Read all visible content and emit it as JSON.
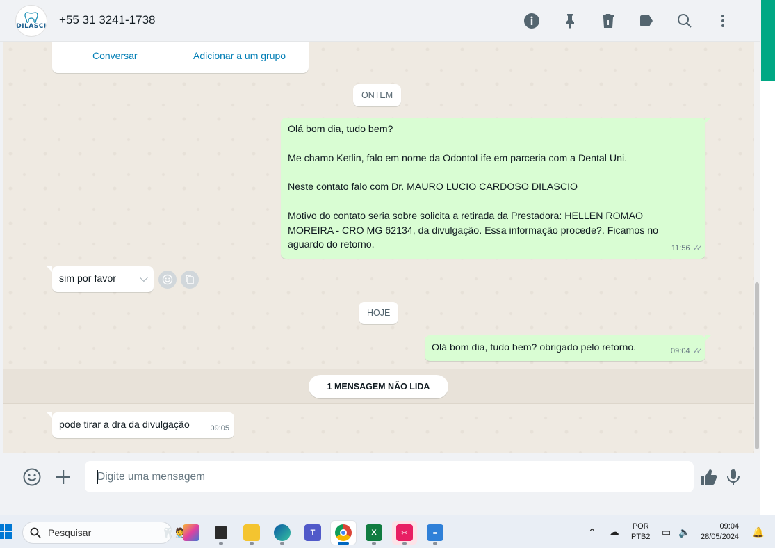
{
  "header": {
    "avatar_text": "DILASCI",
    "contact_name": "+55 31 3241-1738",
    "icons": [
      "info-icon",
      "pin-icon",
      "clear-chat-icon",
      "label-icon",
      "search-icon",
      "more-options-icon"
    ]
  },
  "contact_card": {
    "chat_label": "Conversar",
    "add_group_label": "Adicionar a um grupo"
  },
  "day_chips": {
    "yesterday": "ONTEM",
    "today": "HOJE"
  },
  "messages": [
    {
      "direction": "outgoing",
      "lines": [
        "Olá bom dia, tudo bem?",
        "Me chamo Ketlin, falo em nome da OdontoLife em parceria com a Dental Uni.",
        "Neste contato falo com Dr. MAURO LUCIO CARDOSO DILASCIO",
        "Motivo do contato seria sobre solicita a retirada da Prestadora: HELLEN ROMAO MOREIRA - CRO MG 62134, da divulgação. Essa informação procede?. Ficamos no aguardo do retorno."
      ],
      "time": "11:56",
      "status": "read"
    },
    {
      "direction": "incoming",
      "text": "sim por favor",
      "time": ""
    },
    {
      "direction": "outgoing",
      "text": "Olá bom dia, tudo bem? obrigado pelo retorno.",
      "time": "09:04",
      "status": "read"
    },
    {
      "direction": "incoming",
      "text": "pode tirar a dra da divulgação",
      "time": "09:05"
    }
  ],
  "unread_divider": "1 MENSAGEM NÃO LIDA",
  "composer": {
    "placeholder": "Digite uma mensagem"
  },
  "taskbar": {
    "search_label": "Pesquisar",
    "language_top": "POR",
    "language_bottom": "PTB2",
    "time": "09:04",
    "date": "28/05/2024"
  },
  "colors": {
    "outgoing_bubble": "#d9fdd3",
    "incoming_bubble": "#ffffff",
    "chat_background": "#efeae2",
    "link": "#027eb5",
    "accent": "#00a884"
  }
}
